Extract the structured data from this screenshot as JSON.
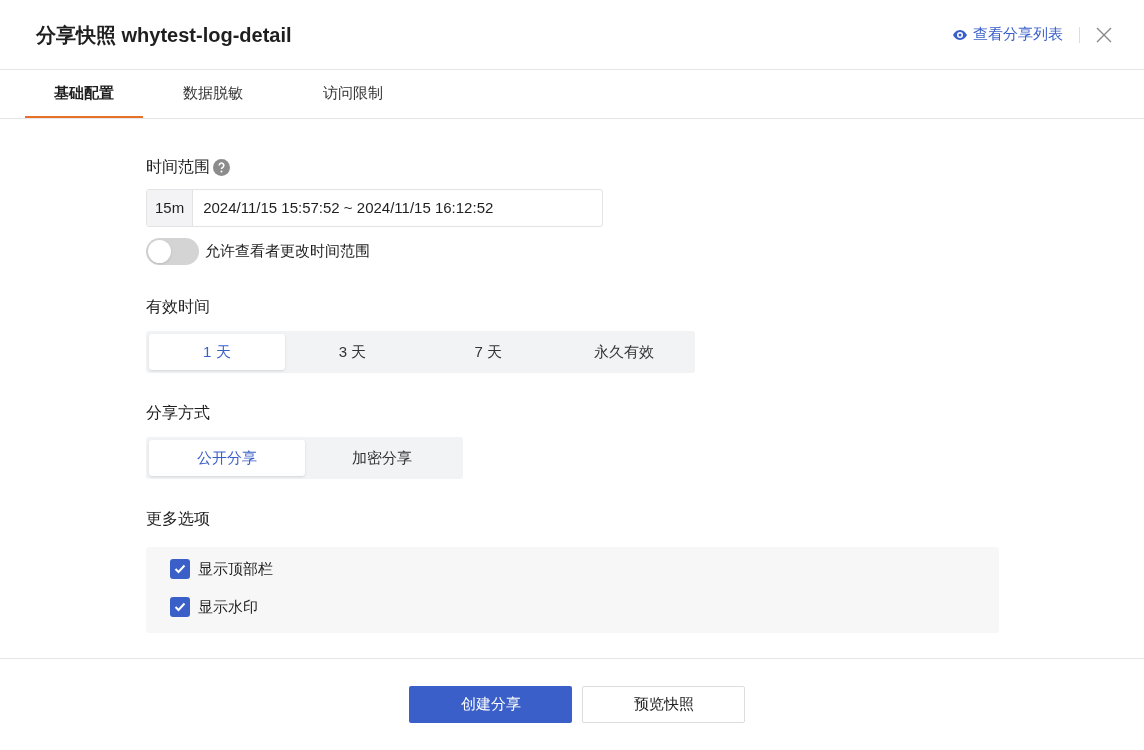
{
  "title": "分享快照 whytest-log-detail",
  "header_link": "查看分享列表",
  "tabs": [
    {
      "label": "基础配置",
      "selected": true
    },
    {
      "label": "数据脱敏",
      "selected": false
    },
    {
      "label": "访问限制",
      "selected": false
    }
  ],
  "time_range": {
    "label": "时间范围",
    "preset": "15m",
    "value": "2024/11/15 15:57:52 ~ 2024/11/15 16:12:52"
  },
  "allow_change": {
    "label": "允许查看者更改时间范围",
    "on": false
  },
  "validity": {
    "label": "有效时间",
    "options": [
      {
        "label": "1 天",
        "selected": true
      },
      {
        "label": "3 天",
        "selected": false
      },
      {
        "label": "7 天",
        "selected": false
      },
      {
        "label": "永久有效",
        "selected": false
      }
    ]
  },
  "share_mode": {
    "label": "分享方式",
    "options": [
      {
        "label": "公开分享",
        "selected": true
      },
      {
        "label": "加密分享",
        "selected": false
      }
    ]
  },
  "more_options": {
    "label": "更多选项",
    "items": [
      {
        "label": "显示顶部栏",
        "checked": true
      },
      {
        "label": "显示水印",
        "checked": true
      }
    ]
  },
  "buttons": [
    {
      "label": "创建分享",
      "kind": "primary"
    },
    {
      "label": "预览快照",
      "kind": "secondary"
    }
  ]
}
